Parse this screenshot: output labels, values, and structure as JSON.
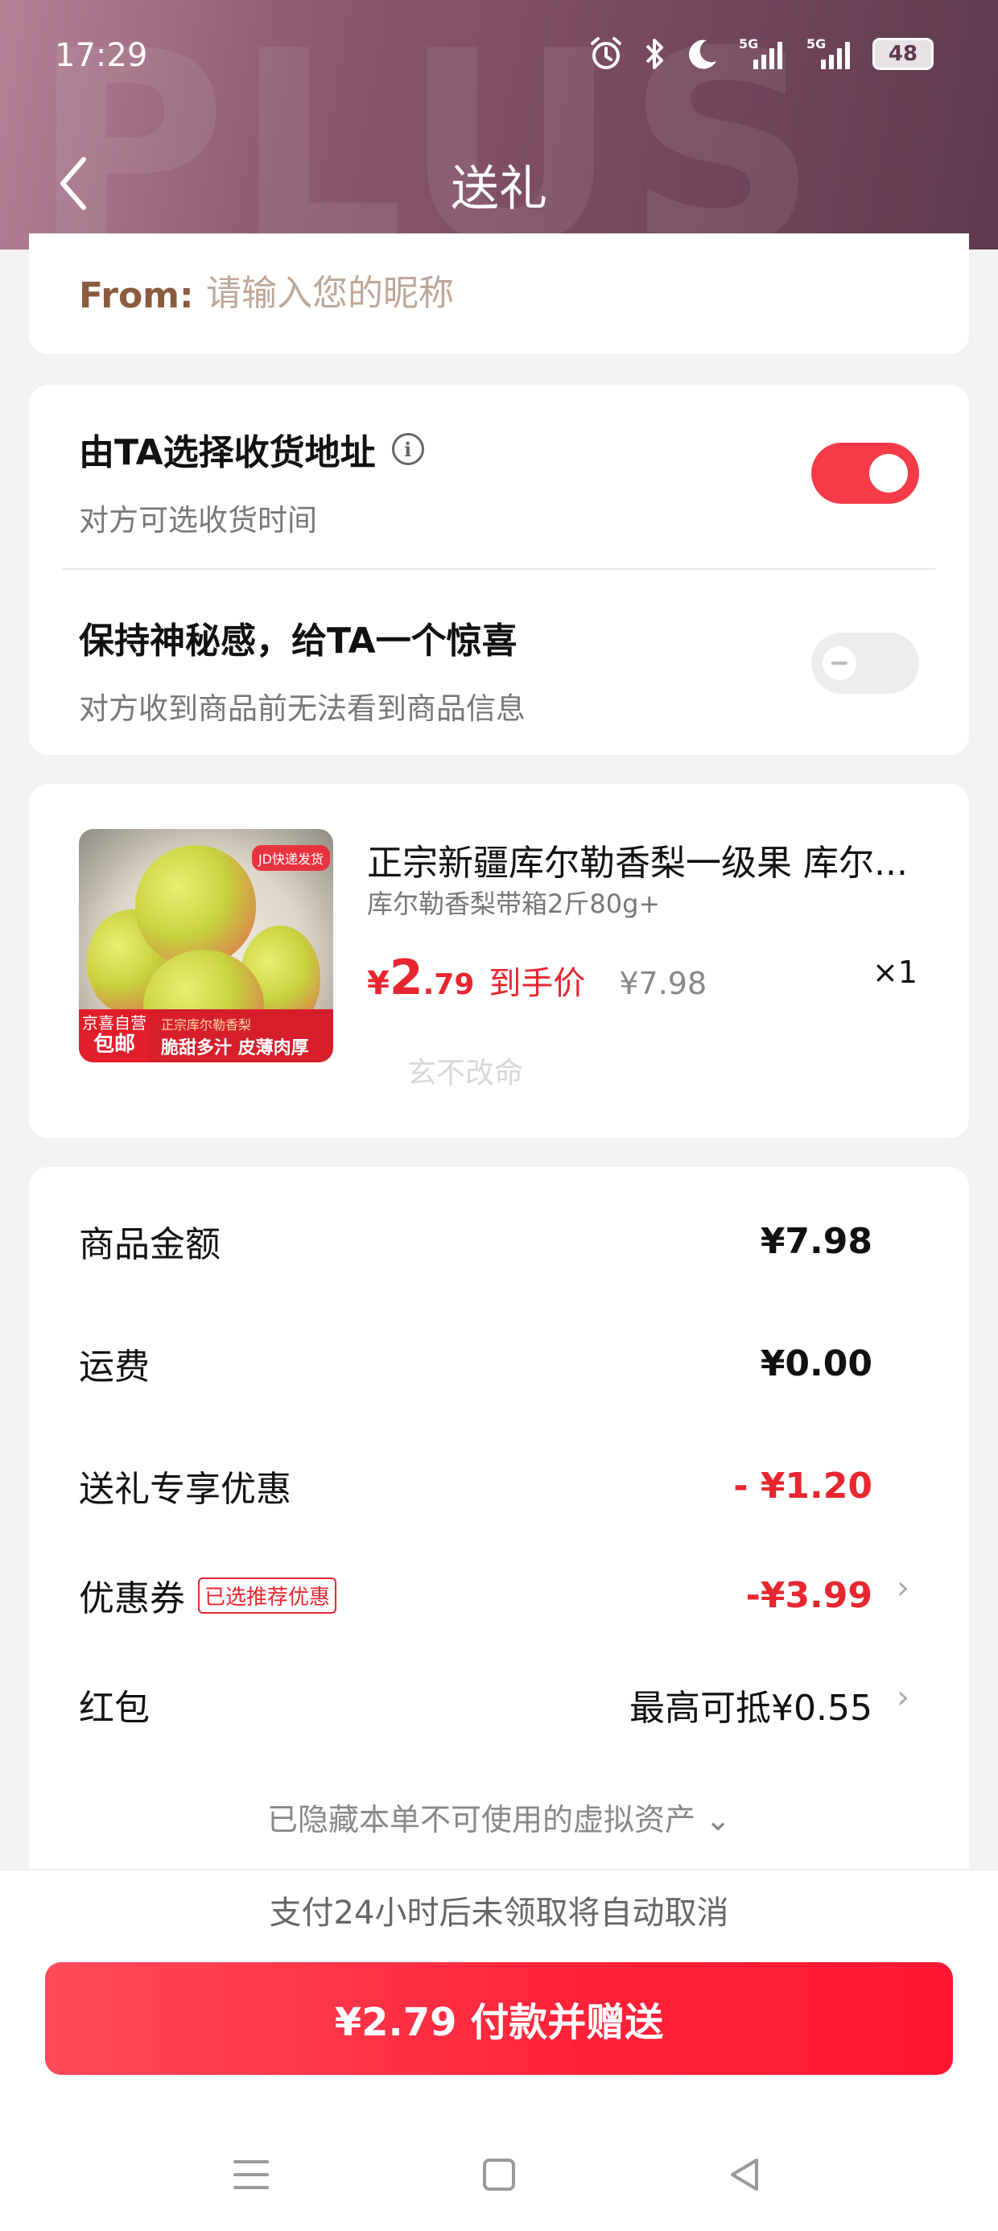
{
  "status_bar": {
    "time": "17:29",
    "battery": "48"
  },
  "header": {
    "title": "送礼",
    "watermark": "PLUS"
  },
  "from": {
    "label": "From:",
    "placeholder": "请输入您的昵称",
    "value": ""
  },
  "options": [
    {
      "title": "由TA选择收货地址",
      "subtitle": "对方可选收货时间",
      "enabled": true
    },
    {
      "title": "保持神秘感，给TA一个惊喜",
      "subtitle": "对方收到商品前无法看到商品信息",
      "enabled": false
    }
  ],
  "product": {
    "title": "正宗新疆库尔勒香梨一级果 库尔...",
    "spec": "库尔勒香梨带箱2斤80g+",
    "price_currency": "¥",
    "price_int": "2",
    "price_dec": ".79",
    "price_label": "到手价",
    "original_price": "¥7.98",
    "quantity": "×1",
    "image_tags": {
      "top": "JD快递发货",
      "left_small": "京喜自营",
      "left_big": "包邮",
      "banner_small": "正宗库尔勒香梨",
      "banner_big": "脆甜多汁 皮薄肉厚"
    },
    "shop_watermark": "玄不改命"
  },
  "amounts": [
    {
      "label": "商品金额",
      "value": "¥7.98"
    },
    {
      "label": "运费",
      "value": "¥0.00"
    },
    {
      "label": "送礼专享优惠",
      "value": "- ¥1.20"
    },
    {
      "label": "优惠券",
      "tag": "已选推荐优惠",
      "value": "-¥3.99"
    },
    {
      "label": "红包",
      "value": "最高可抵¥0.55"
    }
  ],
  "hidden_assets": "已隐藏本单不可使用的虚拟资产",
  "notice": "支付24小时后未领取将自动取消",
  "pay_button": "¥2.79 付款并赠送",
  "colors": {
    "accent": "#f53a48",
    "header": "#7a4a60",
    "price_red": "#e8262f"
  }
}
